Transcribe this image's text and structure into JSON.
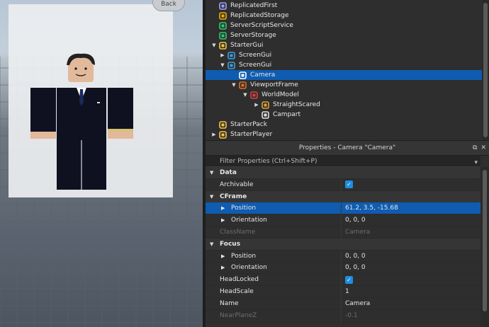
{
  "viewport": {
    "back_label": "Back"
  },
  "explorer": {
    "items": [
      {
        "label": "ReplicatedFirst",
        "icon": "replicated-first-icon",
        "color": "#a0a0ff",
        "arrow": "",
        "selected": false
      },
      {
        "label": "ReplicatedStorage",
        "icon": "replicated-storage-icon",
        "color": "#f0b000",
        "arrow": "",
        "selected": false
      },
      {
        "label": "ServerScriptService",
        "icon": "server-script-service-icon",
        "color": "#2ecc71",
        "arrow": "",
        "selected": false
      },
      {
        "label": "ServerStorage",
        "icon": "server-storage-icon",
        "color": "#2ecc71",
        "arrow": "",
        "selected": false
      },
      {
        "label": "StarterGui",
        "icon": "starter-gui-icon",
        "color": "#f5c542",
        "arrow": "▼",
        "selected": false
      },
      {
        "label": "ScreenGui",
        "icon": "screen-gui-icon",
        "color": "#3aa0e0",
        "arrow": "▶",
        "selected": false
      },
      {
        "label": "ScreenGui",
        "icon": "screen-gui-icon",
        "color": "#3aa0e0",
        "arrow": "▼",
        "selected": false
      },
      {
        "label": "Camera",
        "icon": "camera-icon",
        "color": "#ffffff",
        "arrow": "",
        "selected": true
      },
      {
        "label": "ViewportFrame",
        "icon": "viewport-frame-icon",
        "color": "#e07020",
        "arrow": "▼",
        "selected": false
      },
      {
        "label": "WorldModel",
        "icon": "world-model-icon",
        "color": "#e04040",
        "arrow": "▼",
        "selected": false
      },
      {
        "label": "StraightScared",
        "icon": "model-icon",
        "color": "#e0a030",
        "arrow": "▶",
        "selected": false
      },
      {
        "label": "Campart",
        "icon": "part-icon",
        "color": "#e0e0e0",
        "arrow": "",
        "selected": false
      },
      {
        "label": "StarterPack",
        "icon": "starter-pack-icon",
        "color": "#f5c542",
        "arrow": "",
        "selected": false
      },
      {
        "label": "StarterPlayer",
        "icon": "starter-player-icon",
        "color": "#f5c542",
        "arrow": "▶",
        "selected": false
      }
    ]
  },
  "properties": {
    "title": "Properties - Camera \"Camera\"",
    "filter_placeholder": "Filter Properties (Ctrl+Shift+P)",
    "rows": [
      {
        "kind": "category",
        "name": "Data"
      },
      {
        "kind": "prop",
        "name": "Archivable",
        "value": "",
        "checkbox": true
      },
      {
        "kind": "category",
        "name": "CFrame"
      },
      {
        "kind": "prop",
        "name": "Position",
        "value": "61.2, 3.5, -15.68",
        "expand": true,
        "selected": true
      },
      {
        "kind": "prop",
        "name": "Orientation",
        "value": "0, 0, 0",
        "expand": true
      },
      {
        "kind": "prop",
        "name": "ClassName",
        "value": "Camera",
        "disabled": true
      },
      {
        "kind": "category",
        "name": "Focus"
      },
      {
        "kind": "prop",
        "name": "Position",
        "value": "0, 0, 0",
        "expand": true
      },
      {
        "kind": "prop",
        "name": "Orientation",
        "value": "0, 0, 0",
        "expand": true
      },
      {
        "kind": "prop",
        "name": "HeadLocked",
        "value": "",
        "checkbox": true
      },
      {
        "kind": "prop",
        "name": "HeadScale",
        "value": "1"
      },
      {
        "kind": "prop",
        "name": "Name",
        "value": "Camera"
      },
      {
        "kind": "prop",
        "name": "NearPlaneZ",
        "value": "-0.1",
        "disabled": true
      }
    ]
  },
  "colors": {
    "selection": "#0f5cb1",
    "checkbox": "#1e8fe0",
    "panel_bg": "#2e2e2e"
  }
}
